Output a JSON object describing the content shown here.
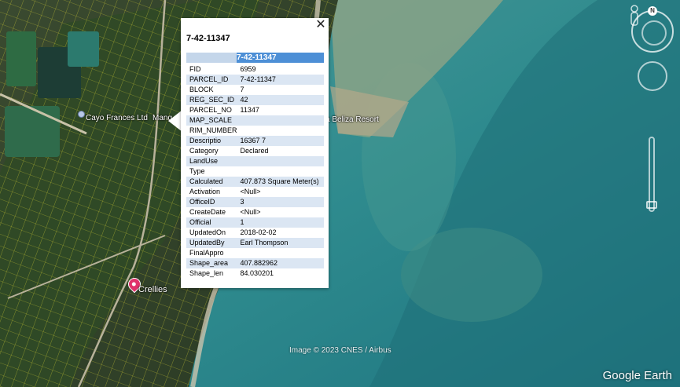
{
  "map": {
    "labels": {
      "cayo": "Cayo Frances Ltd",
      "mang": "Mang",
      "beliza": "a Beliza Resort",
      "crellies": "Crellies"
    },
    "credit": "Image © 2023 CNES / Airbus",
    "logo": "Google Earth",
    "compass_letter": "N"
  },
  "popup": {
    "title": "7-42-11347",
    "header_value": "7-42-11347",
    "close_label": "✕",
    "rows": [
      {
        "key": "FID",
        "value": "6959"
      },
      {
        "key": "PARCEL_ID",
        "value": "7-42-11347"
      },
      {
        "key": "BLOCK",
        "value": "7"
      },
      {
        "key": "REG_SEC_ID",
        "value": "42"
      },
      {
        "key": "PARCEL_NO",
        "value": "11347"
      },
      {
        "key": "MAP_SCALE",
        "value": ""
      },
      {
        "key": "RIM_NUMBER",
        "value": ""
      },
      {
        "key": "Descriptio",
        "value": "16367 7"
      },
      {
        "key": "Category",
        "value": "Declared"
      },
      {
        "key": "LandUse",
        "value": ""
      },
      {
        "key": "Type",
        "value": ""
      },
      {
        "key": "Calculated",
        "value": "407.873 Square Meter(s)"
      },
      {
        "key": "Activation",
        "value": "<Null>"
      },
      {
        "key": "OfficeID",
        "value": "3"
      },
      {
        "key": "CreateDate",
        "value": "<Null>"
      },
      {
        "key": "Official",
        "value": "1"
      },
      {
        "key": "UpdatedOn",
        "value": "2018-02-02"
      },
      {
        "key": "UpdatedBy",
        "value": "Earl Thompson"
      },
      {
        "key": "FinalAppro",
        "value": ""
      },
      {
        "key": "Shape_area",
        "value": "407.882962"
      },
      {
        "key": "Shape_len",
        "value": "84.030201"
      }
    ]
  },
  "colors": {
    "header_blue": "#4d8fd6",
    "row_stripe": "#dbe6f3",
    "parcel_lines": "#e6e033"
  }
}
